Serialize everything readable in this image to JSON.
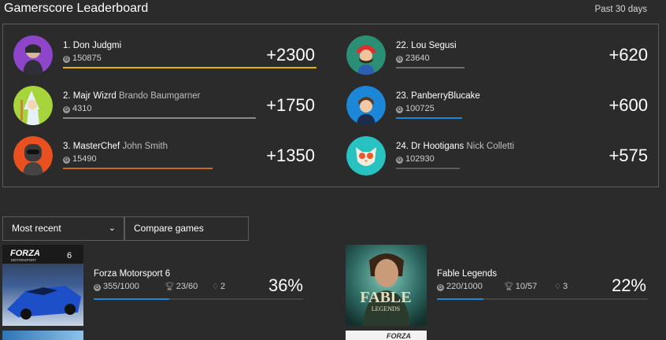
{
  "header": {
    "title": "Gamerscore Leaderboard",
    "period": "Past 30 days"
  },
  "leaderboard": [
    {
      "label": "1. Don Judgmi",
      "real_name": "",
      "score": "150875",
      "delta": "+2300",
      "bar_color": "#e8b100",
      "bar_fraction": 1.0
    },
    {
      "label": "2. Majr Wizrd",
      "real_name": "Brando Baumgarner",
      "score": "4310",
      "delta": "+1750",
      "bar_color": "#8a8a8a",
      "bar_fraction": 0.76
    },
    {
      "label": "3. MasterChef",
      "real_name": "John Smith",
      "score": "15490",
      "delta": "+1350",
      "bar_color": "#c56a24",
      "bar_fraction": 0.59
    },
    {
      "label": "22. Lou Segusi",
      "real_name": "",
      "score": "23640",
      "delta": "+620",
      "bar_color": "#6f6f6f",
      "bar_fraction": 0.27
    },
    {
      "label": "23. PanberryBlucake",
      "real_name": "",
      "score": "100725",
      "delta": "+600",
      "bar_color": "#1b87d6",
      "bar_fraction": 0.26
    },
    {
      "label": "24. Dr Hootigans",
      "real_name": "Nick Colletti",
      "score": "102930",
      "delta": "+575",
      "bar_color": "#5e5e5e",
      "bar_fraction": 0.25
    }
  ],
  "filters": {
    "sort_label": "Most recent",
    "compare_label": "Compare games"
  },
  "games": [
    {
      "title": "Forza Motorsport 6",
      "gamerscore": "355/1000",
      "achievements": "23/60",
      "gems": "2",
      "percent": "36%",
      "progress": 0.36,
      "thumb_text": "FORZA",
      "thumb_sub": "MOTORSPORT",
      "thumb_num": "6"
    },
    {
      "title": "Fable Legends",
      "gamerscore": "220/1000",
      "achievements": "10/57",
      "gems": "3",
      "percent": "22%",
      "progress": 0.22,
      "thumb_text": "FABLE",
      "thumb_sub": "LEGENDS"
    }
  ],
  "next_thumb_text": "FORZA",
  "icons": {
    "gamerscore": "gamerscore-icon",
    "trophy": "trophy-icon",
    "gem": "gem-icon",
    "chevron": "chevron-down-icon"
  }
}
